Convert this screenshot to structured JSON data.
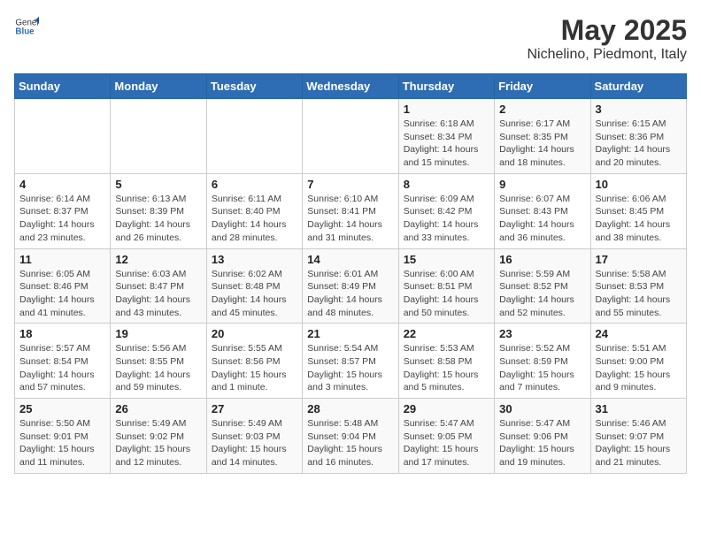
{
  "header": {
    "logo_general": "General",
    "logo_blue": "Blue",
    "title": "May 2025",
    "subtitle": "Nichelino, Piedmont, Italy"
  },
  "weekdays": [
    "Sunday",
    "Monday",
    "Tuesday",
    "Wednesday",
    "Thursday",
    "Friday",
    "Saturday"
  ],
  "weeks": [
    [
      {
        "day": "",
        "info": ""
      },
      {
        "day": "",
        "info": ""
      },
      {
        "day": "",
        "info": ""
      },
      {
        "day": "",
        "info": ""
      },
      {
        "day": "1",
        "info": "Sunrise: 6:18 AM\nSunset: 8:34 PM\nDaylight: 14 hours\nand 15 minutes."
      },
      {
        "day": "2",
        "info": "Sunrise: 6:17 AM\nSunset: 8:35 PM\nDaylight: 14 hours\nand 18 minutes."
      },
      {
        "day": "3",
        "info": "Sunrise: 6:15 AM\nSunset: 8:36 PM\nDaylight: 14 hours\nand 20 minutes."
      }
    ],
    [
      {
        "day": "4",
        "info": "Sunrise: 6:14 AM\nSunset: 8:37 PM\nDaylight: 14 hours\nand 23 minutes."
      },
      {
        "day": "5",
        "info": "Sunrise: 6:13 AM\nSunset: 8:39 PM\nDaylight: 14 hours\nand 26 minutes."
      },
      {
        "day": "6",
        "info": "Sunrise: 6:11 AM\nSunset: 8:40 PM\nDaylight: 14 hours\nand 28 minutes."
      },
      {
        "day": "7",
        "info": "Sunrise: 6:10 AM\nSunset: 8:41 PM\nDaylight: 14 hours\nand 31 minutes."
      },
      {
        "day": "8",
        "info": "Sunrise: 6:09 AM\nSunset: 8:42 PM\nDaylight: 14 hours\nand 33 minutes."
      },
      {
        "day": "9",
        "info": "Sunrise: 6:07 AM\nSunset: 8:43 PM\nDaylight: 14 hours\nand 36 minutes."
      },
      {
        "day": "10",
        "info": "Sunrise: 6:06 AM\nSunset: 8:45 PM\nDaylight: 14 hours\nand 38 minutes."
      }
    ],
    [
      {
        "day": "11",
        "info": "Sunrise: 6:05 AM\nSunset: 8:46 PM\nDaylight: 14 hours\nand 41 minutes."
      },
      {
        "day": "12",
        "info": "Sunrise: 6:03 AM\nSunset: 8:47 PM\nDaylight: 14 hours\nand 43 minutes."
      },
      {
        "day": "13",
        "info": "Sunrise: 6:02 AM\nSunset: 8:48 PM\nDaylight: 14 hours\nand 45 minutes."
      },
      {
        "day": "14",
        "info": "Sunrise: 6:01 AM\nSunset: 8:49 PM\nDaylight: 14 hours\nand 48 minutes."
      },
      {
        "day": "15",
        "info": "Sunrise: 6:00 AM\nSunset: 8:51 PM\nDaylight: 14 hours\nand 50 minutes."
      },
      {
        "day": "16",
        "info": "Sunrise: 5:59 AM\nSunset: 8:52 PM\nDaylight: 14 hours\nand 52 minutes."
      },
      {
        "day": "17",
        "info": "Sunrise: 5:58 AM\nSunset: 8:53 PM\nDaylight: 14 hours\nand 55 minutes."
      }
    ],
    [
      {
        "day": "18",
        "info": "Sunrise: 5:57 AM\nSunset: 8:54 PM\nDaylight: 14 hours\nand 57 minutes."
      },
      {
        "day": "19",
        "info": "Sunrise: 5:56 AM\nSunset: 8:55 PM\nDaylight: 14 hours\nand 59 minutes."
      },
      {
        "day": "20",
        "info": "Sunrise: 5:55 AM\nSunset: 8:56 PM\nDaylight: 15 hours\nand 1 minute."
      },
      {
        "day": "21",
        "info": "Sunrise: 5:54 AM\nSunset: 8:57 PM\nDaylight: 15 hours\nand 3 minutes."
      },
      {
        "day": "22",
        "info": "Sunrise: 5:53 AM\nSunset: 8:58 PM\nDaylight: 15 hours\nand 5 minutes."
      },
      {
        "day": "23",
        "info": "Sunrise: 5:52 AM\nSunset: 8:59 PM\nDaylight: 15 hours\nand 7 minutes."
      },
      {
        "day": "24",
        "info": "Sunrise: 5:51 AM\nSunset: 9:00 PM\nDaylight: 15 hours\nand 9 minutes."
      }
    ],
    [
      {
        "day": "25",
        "info": "Sunrise: 5:50 AM\nSunset: 9:01 PM\nDaylight: 15 hours\nand 11 minutes."
      },
      {
        "day": "26",
        "info": "Sunrise: 5:49 AM\nSunset: 9:02 PM\nDaylight: 15 hours\nand 12 minutes."
      },
      {
        "day": "27",
        "info": "Sunrise: 5:49 AM\nSunset: 9:03 PM\nDaylight: 15 hours\nand 14 minutes."
      },
      {
        "day": "28",
        "info": "Sunrise: 5:48 AM\nSunset: 9:04 PM\nDaylight: 15 hours\nand 16 minutes."
      },
      {
        "day": "29",
        "info": "Sunrise: 5:47 AM\nSunset: 9:05 PM\nDaylight: 15 hours\nand 17 minutes."
      },
      {
        "day": "30",
        "info": "Sunrise: 5:47 AM\nSunset: 9:06 PM\nDaylight: 15 hours\nand 19 minutes."
      },
      {
        "day": "31",
        "info": "Sunrise: 5:46 AM\nSunset: 9:07 PM\nDaylight: 15 hours\nand 21 minutes."
      }
    ]
  ]
}
